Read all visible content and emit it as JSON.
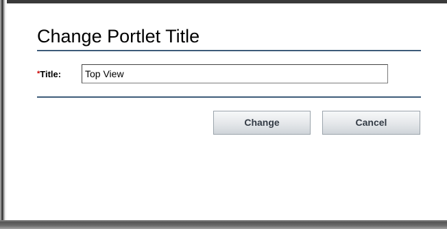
{
  "dialog": {
    "title": "Change Portlet Title",
    "field": {
      "required_marker": "*",
      "label": "Title:",
      "value": "Top View"
    },
    "buttons": {
      "change_label": "Change",
      "cancel_label": "Cancel"
    }
  },
  "colors": {
    "rule": "#3c5a78",
    "required_marker": "#cc0000",
    "button_text": "#333b45"
  }
}
